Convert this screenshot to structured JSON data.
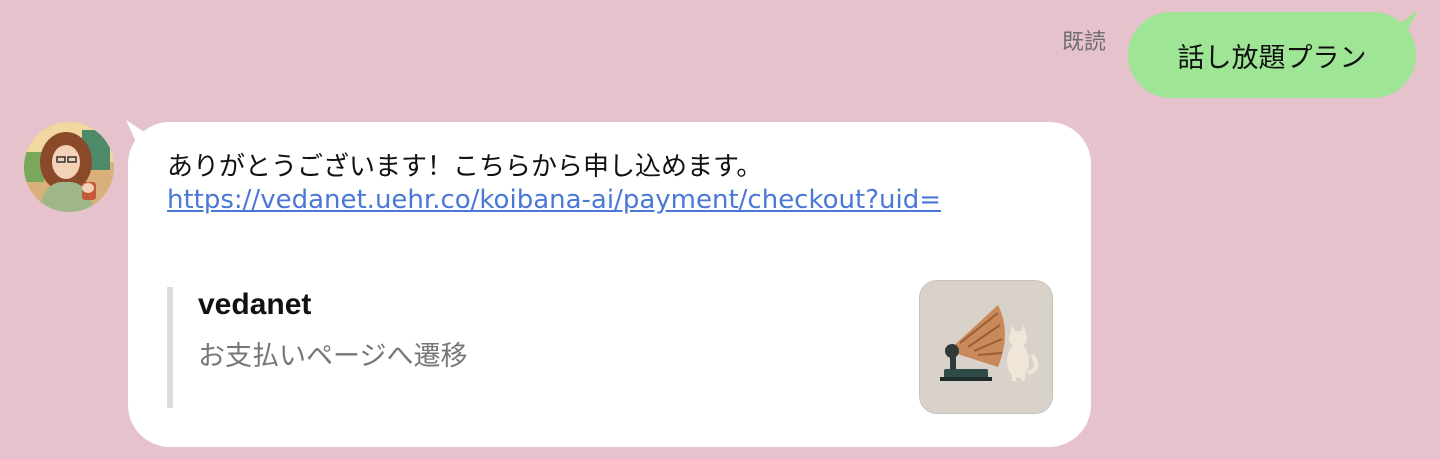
{
  "outgoing": {
    "read_receipt": "既読",
    "text": "話し放題プラン"
  },
  "incoming": {
    "text": "ありがとうございます！こちらから申し込めます。",
    "link": "https://vedanet.uehr.co/koibana-ai/payment/checkout?uid=",
    "preview": {
      "title": "vedanet",
      "description": "お支払いページへ遷移"
    }
  },
  "icons": {
    "avatar": "user-avatar",
    "thumbnail": "gramophone-cat-thumbnail"
  },
  "colors": {
    "background": "#e5c2cc",
    "outgoing_bubble": "#9fe596",
    "incoming_bubble": "#ffffff",
    "link": "#4a78d6"
  }
}
